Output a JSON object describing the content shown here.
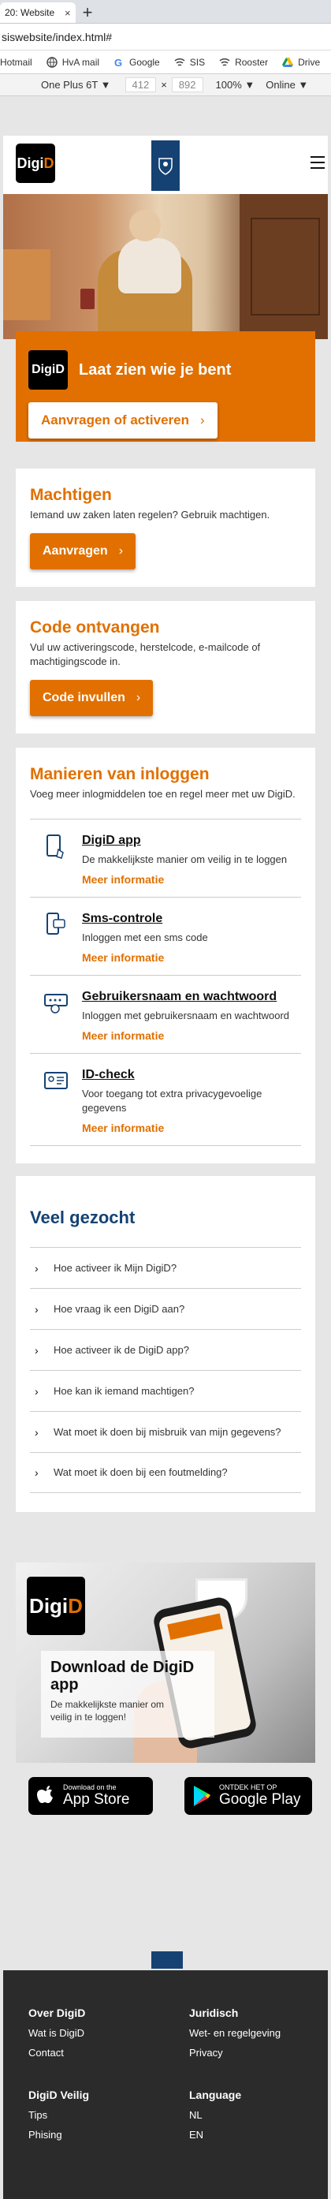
{
  "browser": {
    "tab_title": "20: Website",
    "tab_close": "×",
    "new_tab": "+",
    "url": "siswebsite/index.html#",
    "bookmarks": [
      "Hotmail",
      "HvA mail",
      "Google",
      "SIS",
      "Rooster",
      "Drive"
    ],
    "device": "One Plus 6T ▼",
    "width": "412",
    "times": "×",
    "height": "892",
    "zoom": "100% ▼",
    "network": "Online ▼"
  },
  "header": {
    "logo_a": "Digi",
    "logo_b": "D"
  },
  "login_box": {
    "logo": "DigiD",
    "title": "Laat zien wie je bent",
    "button": "Aanvragen of activeren"
  },
  "machtigen": {
    "title": "Machtigen",
    "desc": "Iemand uw zaken laten regelen? Gebruik machtigen.",
    "button": "Aanvragen"
  },
  "code": {
    "title": "Code ontvangen",
    "desc": "Vul uw activeringscode, herstelcode, e-mailcode of machtigingscode in.",
    "button": "Code invullen"
  },
  "methods": {
    "title": "Manieren van inloggen",
    "desc": "Voeg meer inlogmiddelen toe en regel meer met uw DigiD.",
    "items": [
      {
        "title": "DigiD app",
        "desc": "De makkelijkste manier om veilig in te loggen",
        "link": "Meer informatie"
      },
      {
        "title": "Sms-controle",
        "desc": "Inloggen met een sms code",
        "link": "Meer informatie"
      },
      {
        "title": "Gebruikersnaam en wachtwoord",
        "desc": "Inloggen met gebruikersnaam en wachtwoord",
        "link": "Meer informatie"
      },
      {
        "title": "ID-check",
        "desc": "Voor toegang tot extra privacygevoelige gegevens",
        "link": "Meer informatie"
      }
    ]
  },
  "faq": {
    "title": "Veel gezocht",
    "items": [
      "Hoe activeer ik Mijn DigiD?",
      "Hoe vraag ik een DigiD aan?",
      "Hoe activeer ik de DigiD app?",
      "Hoe kan ik iemand machtigen?",
      "Wat moet ik doen bij misbruik van mijn gegevens?",
      "Wat moet ik doen bij een foutmelding?"
    ]
  },
  "app_banner": {
    "logo_a": "Digi",
    "logo_b": "D",
    "title": "Download de DigiD app",
    "desc": "De makkelijkste manier om veilig in te loggen!"
  },
  "stores": {
    "apple_small": "Download on the",
    "apple_big": "App Store",
    "google_small": "ONTDEK HET OP",
    "google_big": "Google Play"
  },
  "footer": {
    "col1": {
      "heading": "Over DigiD",
      "links": [
        "Wat is DigiD",
        "Contact"
      ]
    },
    "col2": {
      "heading": "Juridisch",
      "links": [
        "Wet- en regelgeving",
        "Privacy"
      ]
    },
    "col3": {
      "heading": "DigiD Veilig",
      "links": [
        "Tips",
        "Phising"
      ]
    },
    "col4": {
      "heading": "Language",
      "links": [
        "NL",
        "EN"
      ]
    }
  },
  "colors": {
    "accent": "#e17000",
    "brand": "#154273",
    "footer": "#2b2b2b"
  },
  "chevron": "›",
  "faq_chevron": "›"
}
